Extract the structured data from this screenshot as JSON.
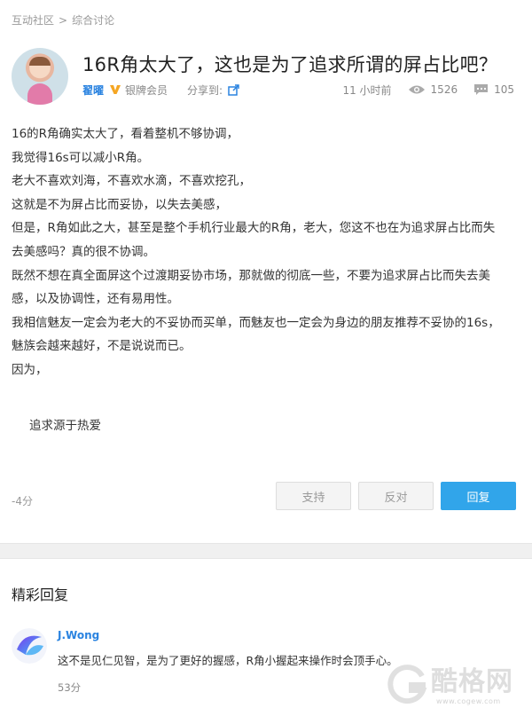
{
  "breadcrumb": {
    "items": [
      "互动社区",
      "综合讨论"
    ],
    "separator": ">"
  },
  "post": {
    "title": "16R角太大了，这也是为了追求所谓的屏占比吧？",
    "author": {
      "name": "翟曜",
      "level": "银牌会员",
      "avatar_icon": "avatar"
    },
    "share_label": "分享到:",
    "time": "11 小时前",
    "views": "1526",
    "comments": "105",
    "body": [
      "16的R角确实太大了，看着整机不够协调，",
      "我觉得16s可以减小R角。",
      "老大不喜欢刘海，不喜欢水滴，不喜欢挖孔，",
      "这就是不为屏占比而妥协，以失去美感，",
      "但是，R角如此之大，甚至是整个手机行业最大的R角，老大，您这不也在为追求屏占比而失",
      "去美感吗？真的很不协调。",
      "既然不想在真全面屏这个过渡期妥协市场，那就做的彻底一些，不要为追求屏占比而失去美",
      "感，以及协调性，还有易用性。",
      "我相信魅友一定会为老大的不妥协而买单，而魅友也一定会为身边的朋友推荐不妥协的16s，",
      "魅族会越来越好，不是说说而已。",
      "因为，"
    ],
    "signature": "追求源于热爱",
    "score": "-4分",
    "actions": {
      "support": "支持",
      "oppose": "反对",
      "reply": "回复"
    }
  },
  "replies_section": {
    "title": "精彩回复",
    "items": [
      {
        "name": "J.Wong",
        "text": "这不是见仁见智，是为了更好的握感，R角小握起来操作时会顶手心。",
        "score": "53分"
      }
    ]
  },
  "watermark": {
    "text": "酷格网",
    "url": "www.cogew.com"
  },
  "colors": {
    "link_blue": "#2a83e0",
    "reply_button": "#31a5ea",
    "vip_badge": "#f5a623"
  }
}
